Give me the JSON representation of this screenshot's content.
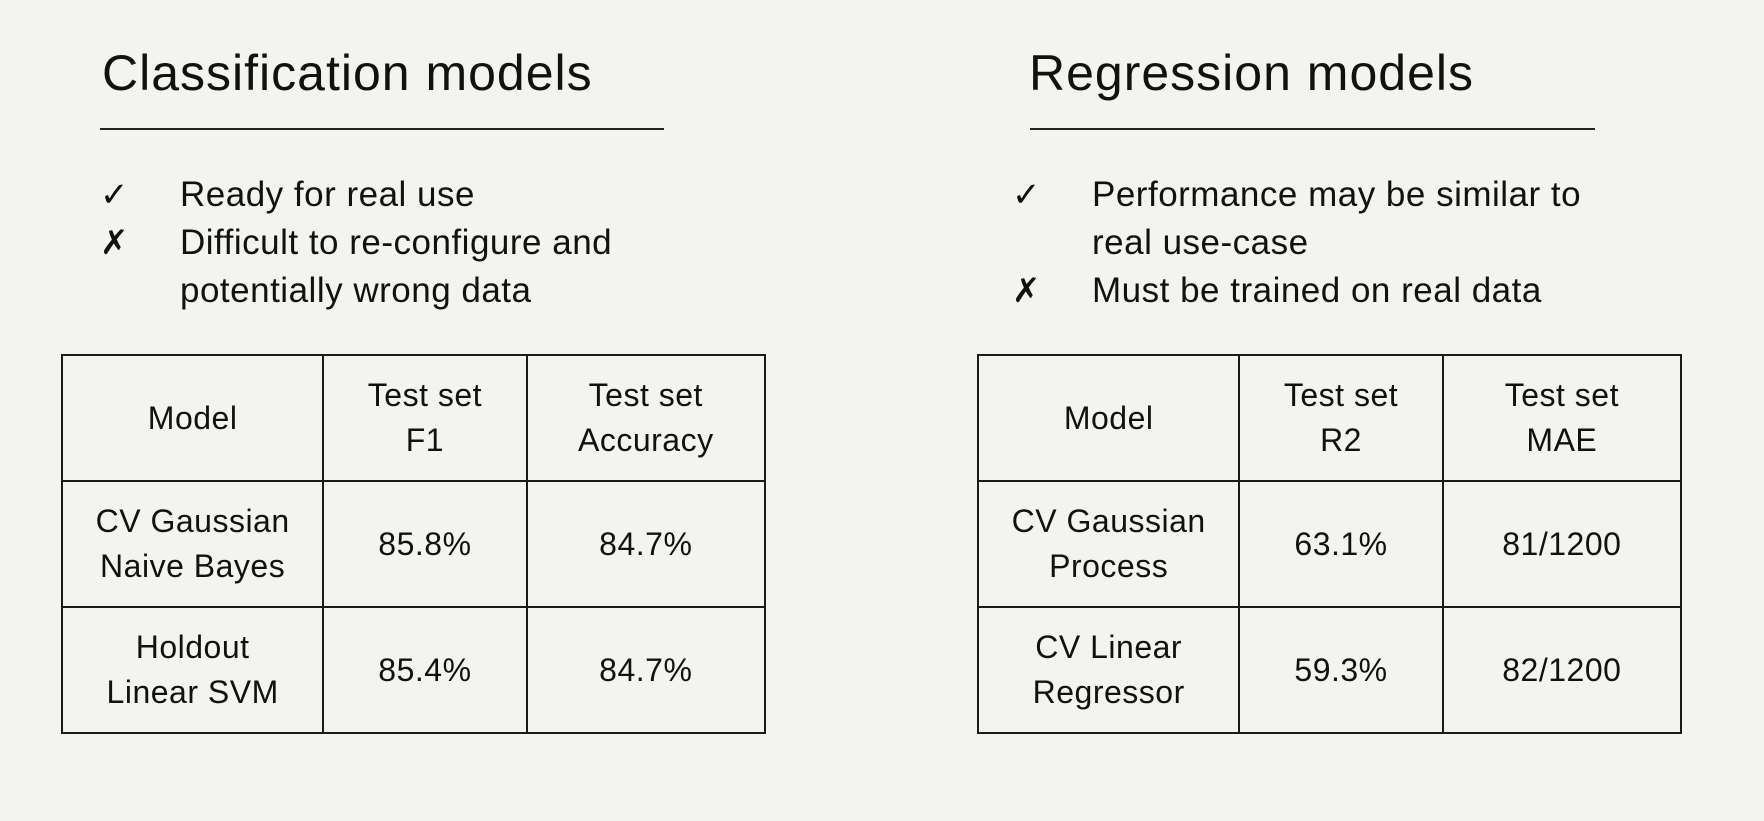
{
  "classification": {
    "title": "Classification models",
    "pros_cons": [
      {
        "icon": "check-icon",
        "glyph": "✓",
        "text": "Ready for real use"
      },
      {
        "icon": "cross-icon",
        "glyph": "✗",
        "text": "Difficult to re-configure and\npotentially wrong data"
      }
    ],
    "table": {
      "headers": [
        "Model",
        "Test set\nF1",
        "Test set\nAccuracy"
      ],
      "rows": [
        [
          "CV Gaussian\nNaive Bayes",
          "85.8%",
          "84.7%"
        ],
        [
          "Holdout\nLinear SVM",
          "85.4%",
          "84.7%"
        ]
      ]
    }
  },
  "regression": {
    "title": "Regression models",
    "pros_cons": [
      {
        "icon": "check-icon",
        "glyph": "✓",
        "text": "Performance may be similar to\nreal use-case"
      },
      {
        "icon": "cross-icon",
        "glyph": "✗",
        "text": "Must be trained on real data"
      }
    ],
    "table": {
      "headers": [
        "Model",
        "Test set\nR2",
        "Test set\nMAE"
      ],
      "rows": [
        [
          "CV Gaussian\nProcess",
          "63.1%",
          "81/1200"
        ],
        [
          "CV Linear\nRegressor",
          "59.3%",
          "82/1200"
        ]
      ]
    }
  }
}
